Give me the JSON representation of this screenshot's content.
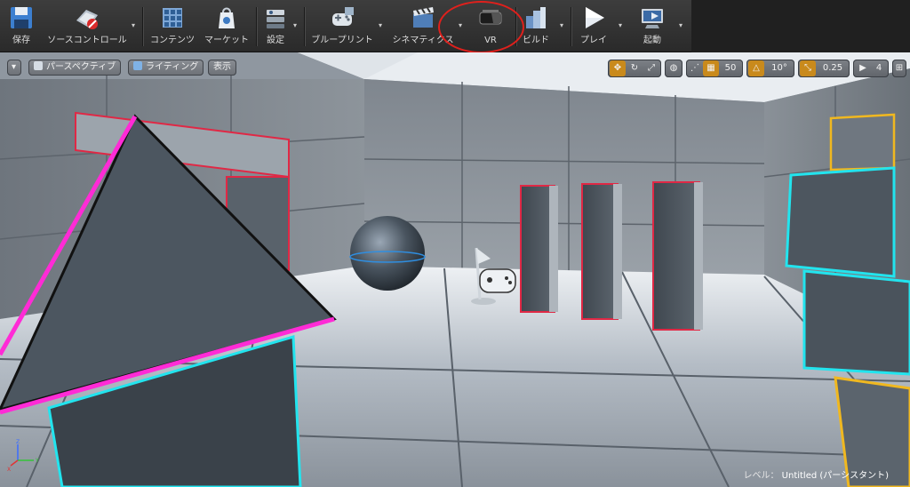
{
  "toolbar": {
    "buttons": [
      {
        "id": "save",
        "label": "保存",
        "icon": "save-icon"
      },
      {
        "id": "source",
        "label": "ソースコントロール",
        "icon": "source-control-icon"
      },
      {
        "id": "content",
        "label": "コンテンツ",
        "icon": "content-browser-icon"
      },
      {
        "id": "market",
        "label": "マーケット",
        "icon": "marketplace-icon"
      },
      {
        "id": "settings",
        "label": "設定",
        "icon": "settings-icon"
      },
      {
        "id": "blueprint",
        "label": "ブループリント",
        "icon": "blueprint-icon"
      },
      {
        "id": "cinematics",
        "label": "シネマティクス",
        "icon": "cinematics-icon"
      },
      {
        "id": "vr",
        "label": "VR",
        "icon": "vr-headset-icon"
      },
      {
        "id": "build",
        "label": "ビルド",
        "icon": "build-icon"
      },
      {
        "id": "play",
        "label": "プレイ",
        "icon": "play-icon"
      },
      {
        "id": "launch",
        "label": "起動",
        "icon": "launch-icon"
      }
    ]
  },
  "viewport": {
    "menu_icon": "chevron-down-icon",
    "perspective_label": "パースペクティブ",
    "lighting_label": "ライティング",
    "show_label": "表示",
    "grid_snap": "50",
    "rotation_snap": "10°",
    "scale_snap": "0.25",
    "camera_speed": "4",
    "level_prefix": "レベル：",
    "level_name": "Untitled (パーシスタント)"
  },
  "colors": {
    "accent_orange": "#c98a1c",
    "selection_red": "#d8203a",
    "selection_magenta": "#ff2bd6",
    "selection_cyan": "#22e4ee",
    "selection_yellow": "#f0b820"
  }
}
